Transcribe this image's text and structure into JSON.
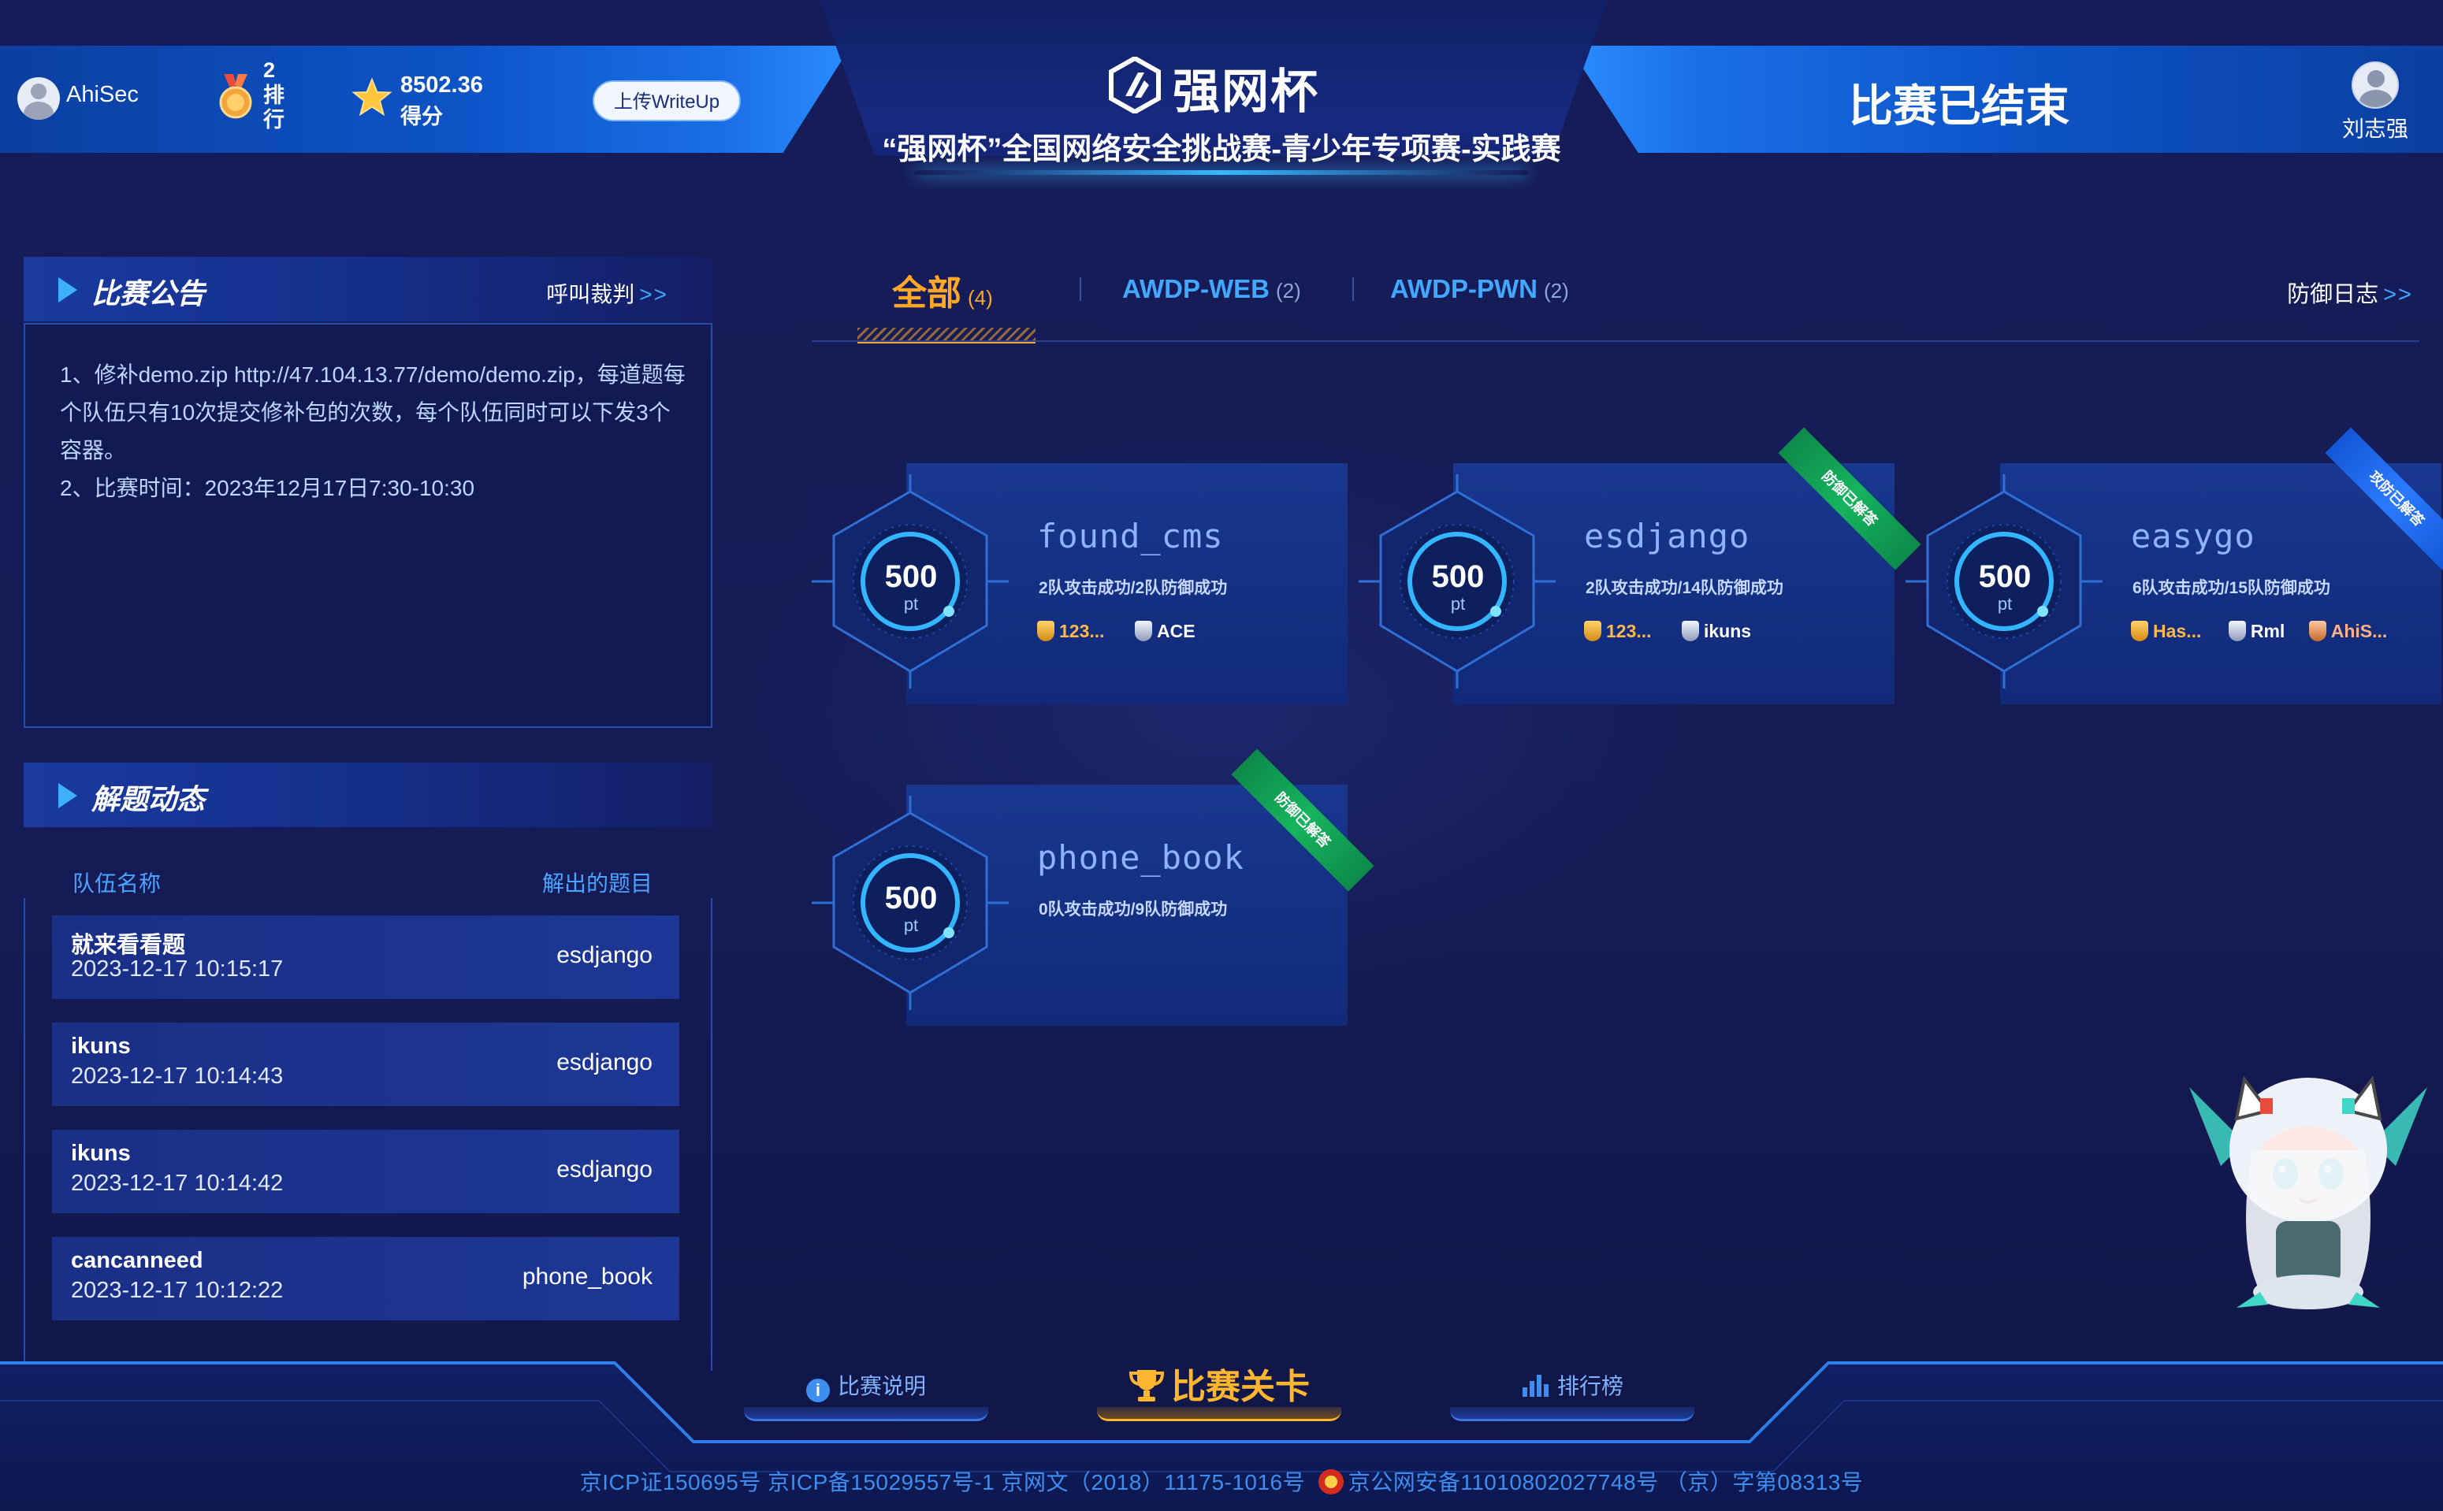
{
  "header": {
    "team_name": "AhiSec",
    "rank_value": "2",
    "rank_label": "排行",
    "score_value": "8502.36",
    "score_label": "得分",
    "upload_button": "上传WriteUp",
    "logo_text": "强网杯",
    "competition_title": "“强网杯”全国网络安全挑战赛-青少年专项赛-实践赛",
    "status": "比赛已结束",
    "admin_name": "刘志强"
  },
  "announcements": {
    "title": "比赛公告",
    "link_label": "呼叫裁判",
    "link_arrow": ">>",
    "lines": [
      "1、修补demo.zip http://47.104.13.77/demo/demo.zip，每道题每个队伍只有10次提交修补包的次数，每个队伍同时可以下发3个容器。",
      "2、比赛时间：2023年12月17日7:30-10:30"
    ]
  },
  "solves": {
    "title": "解题动态",
    "col_team": "队伍名称",
    "col_challenge": "解出的题目",
    "rows": [
      {
        "team": "就来看看题",
        "time": "2023-12-17 10:15:17",
        "challenge": "esdjango"
      },
      {
        "team": "ikuns",
        "time": "2023-12-17 10:14:43",
        "challenge": "esdjango"
      },
      {
        "team": "ikuns",
        "time": "2023-12-17 10:14:42",
        "challenge": "esdjango"
      },
      {
        "team": "cancanneed",
        "time": "2023-12-17 10:12:22",
        "challenge": "phone_book"
      }
    ]
  },
  "tabs": [
    {
      "label": "全部",
      "count": "(4)",
      "active": true
    },
    {
      "label": "AWDP-WEB",
      "count": "(2)",
      "active": false
    },
    {
      "label": "AWDP-PWN",
      "count": "(2)",
      "active": false
    }
  ],
  "defense_log": {
    "label": "防御日志",
    "arrow": ">>"
  },
  "challenges": [
    {
      "name": "found_cms",
      "points": "500",
      "unit": "pt",
      "stats": "2队攻击成功/2队防御成功",
      "bloods": [
        {
          "rank": "gold",
          "team": "123..."
        },
        {
          "rank": "silver",
          "team": "ACE"
        }
      ],
      "ribbon": null
    },
    {
      "name": "esdjango",
      "points": "500",
      "unit": "pt",
      "stats": "2队攻击成功/14队防御成功",
      "bloods": [
        {
          "rank": "gold",
          "team": "123..."
        },
        {
          "rank": "silver",
          "team": "ikuns"
        }
      ],
      "ribbon": {
        "text": "防御已解答",
        "color": "#16b45e"
      }
    },
    {
      "name": "easygo",
      "points": "500",
      "unit": "pt",
      "stats": "6队攻击成功/15队防御成功",
      "bloods": [
        {
          "rank": "gold",
          "team": "Has..."
        },
        {
          "rank": "silver",
          "team": "Rml"
        },
        {
          "rank": "bronze",
          "team": "AhiS..."
        }
      ],
      "ribbon": {
        "text": "攻防已解答",
        "color": "#2b7bff"
      }
    },
    {
      "name": "phone_book",
      "points": "500",
      "unit": "pt",
      "stats": "0队攻击成功/9队防御成功",
      "bloods": [],
      "ribbon": {
        "text": "防御已解答",
        "color": "#16b45e"
      }
    }
  ],
  "bottom_nav": {
    "rules": "比赛说明",
    "levels": "比赛关卡",
    "leaderboard": "排行榜"
  },
  "footer": {
    "icp_left": "京ICP证150695号   京ICP备15029557号-1   京网文（2018）11175-1016号",
    "icp_right": "京公网安备11010802027748号 （京）字第08313号"
  },
  "colors": {
    "background": "#141a52",
    "accent_blue": "#41a7ff",
    "accent_orange": "#ffa726",
    "header_blue": "#0d54c8"
  }
}
